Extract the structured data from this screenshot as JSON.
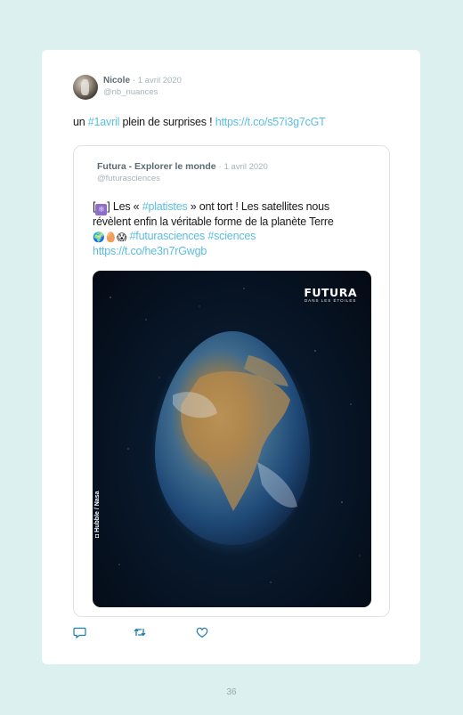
{
  "tweet": {
    "author_name": "Nicole",
    "separator": "·",
    "date": "1 avril 2020",
    "handle": "@nb_nuances",
    "text_before": "un ",
    "hashtag": "#1avril",
    "text_after": " plein de surprises ! ",
    "link": "https://t.co/s57i3g7cGT"
  },
  "quoted": {
    "author_name": "Futura - Explorer le monde",
    "separator": "·",
    "date": "1 avril 2020",
    "handle": "@futurasciences",
    "bracket_open": "[",
    "bracket_close": "]",
    "emoji_atom": "⚛",
    "text_1a": " Les « ",
    "hashtag_1": "#platistes",
    "text_1b": " » ont tort ! Les satellites nous",
    "text_2": "révèlent enfin la véritable forme de la planète Terre",
    "emoji_earth": "🌍",
    "emoji_egg": "🥚",
    "emoji_scream": "😱",
    "hashtag_2": " #futurasciences",
    "hashtag_3": " #sciences",
    "link": "https://t.co/he3n7rGwgb",
    "image": {
      "brand": "FUTURA",
      "brand_sub": "DANS LES ÉTOILES",
      "credit": "Hubble / Nasa"
    }
  },
  "actions": {
    "reply_icon": "reply-icon",
    "retweet_icon": "retweet-icon",
    "like_icon": "heart-icon"
  },
  "page_number": "36",
  "colors": {
    "background": "#dcf0ef",
    "link": "#5bbde0",
    "muted": "#a7b4b9"
  }
}
